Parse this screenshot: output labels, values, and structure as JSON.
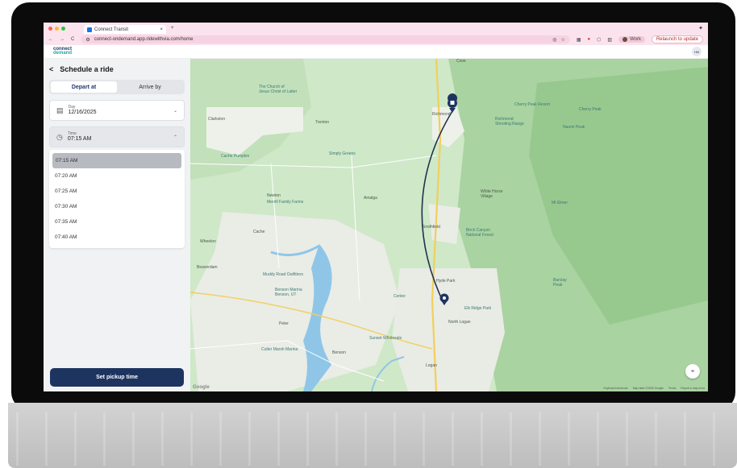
{
  "browser": {
    "tab_title": "Connect Transit",
    "tab_close": "×",
    "new_tab": "+",
    "menu": "✦",
    "url": "connect-ondemand.app.ridewithvia.com/home",
    "profile_label": "Work",
    "relaunch_label": "Relaunch to update",
    "back": "←",
    "forward": "→",
    "reload": "C"
  },
  "app": {
    "logo_line1": "connect",
    "logo_line2": "demand",
    "user_initials": "HM"
  },
  "panel": {
    "back_glyph": "<",
    "title": "Schedule a ride",
    "tabs": [
      "Depart at",
      "Arrive by"
    ],
    "day_label": "Day",
    "day_value": "12/16/2025",
    "time_label": "Time",
    "time_value": "07:15 AM",
    "time_options": [
      "07:15 AM",
      "07:20 AM",
      "07:25 AM",
      "07:30 AM",
      "07:35 AM",
      "07:40 AM"
    ],
    "selected_index": 0,
    "submit_label": "Set pickup time"
  },
  "map": {
    "labels": {
      "cove": "Cove",
      "church": "The Church of\nJesus Christ of Latter",
      "clarkston": "Clarkston",
      "trenton": "Trenton",
      "richmond": "Richmond",
      "cherry_peak": "Cherry Peak",
      "cherry_resort": "Cherry Peak Resort",
      "naomi": "Naomi Peak",
      "richmond_shoot": "Richmond\nShooting Range",
      "pumpkin": "Cache Pumpkin",
      "simply": "Simply Greens",
      "newton": "Newton",
      "newton_farms": "Merrill Family Farms",
      "amalga": "Amalga",
      "white_horse": "White Horse\nVillage",
      "mt_elmer": "Mt Elmer",
      "smithfield": "Smithfield",
      "birch": "Birch Canyon\nNational Forest",
      "cache": "Cache",
      "wheelon": "Wheelon",
      "beaverdam": "Beaverdam",
      "muddy": "Muddy Road Outfitters",
      "benson_marina": "Benson Marina\nBenson, UT",
      "hyde": "Hyde Park",
      "center": "Center",
      "north_logan": "North Logan",
      "elk": "Elk Ridge Park",
      "peter": "Peter",
      "cutler": "Cutler Marsh Marina",
      "benson": "Benson",
      "logan": "Logan",
      "sunset": "Sunset Wholesale",
      "barclay": "Barclay\nPeak"
    },
    "attribution": [
      "Keyboard shortcuts",
      "Map data ©2025 Google",
      "Terms",
      "Report a map error"
    ],
    "brand": "Google",
    "colors": {
      "route": "#22324f",
      "pin": "#1e3460",
      "land": "#cfe8c8"
    }
  }
}
